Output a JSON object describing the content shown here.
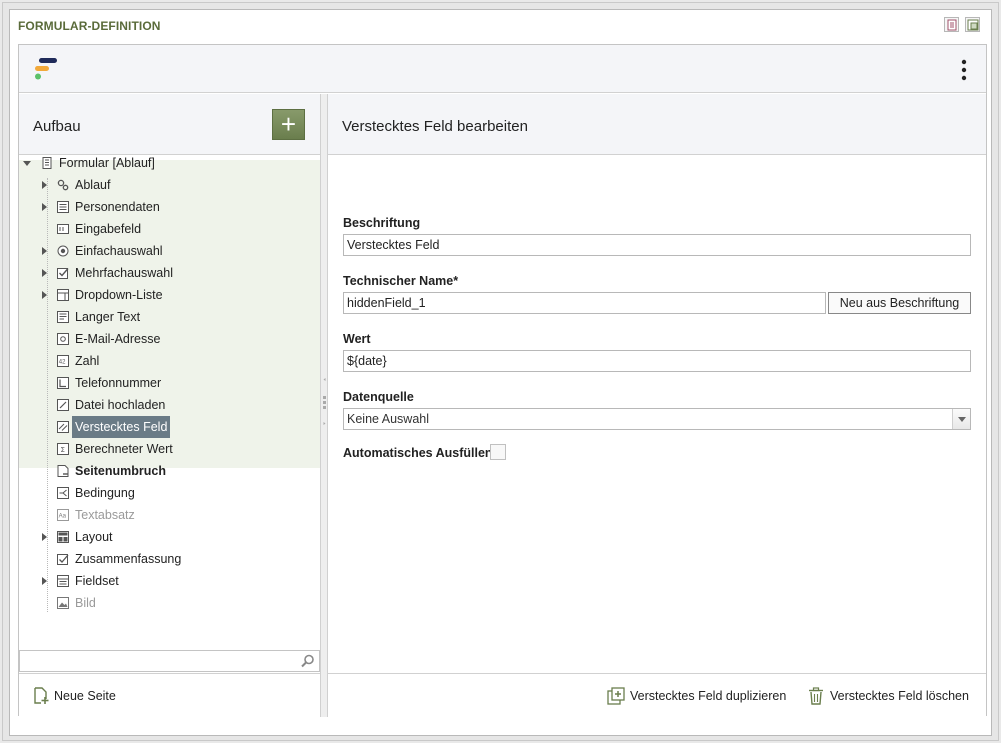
{
  "window": {
    "title": "FORMULAR-DEFINITION"
  },
  "left": {
    "title": "Aufbau",
    "add_label": "+",
    "tree": [
      {
        "label": "Formular [Ablauf]",
        "icon": "form-icon",
        "level": 0,
        "expander": "expanded"
      },
      {
        "label": "Ablauf",
        "icon": "gears-icon",
        "level": 1,
        "expander": "collapsed"
      },
      {
        "label": "Personendaten",
        "icon": "list-icon",
        "level": 1,
        "expander": "collapsed"
      },
      {
        "label": "Eingabefeld",
        "icon": "textfield-icon",
        "level": 1,
        "expander": "none"
      },
      {
        "label": "Einfachauswahl",
        "icon": "radio-icon",
        "level": 1,
        "expander": "collapsed"
      },
      {
        "label": "Mehrfachauswahl",
        "icon": "checkbox-icon",
        "level": 1,
        "expander": "collapsed"
      },
      {
        "label": "Dropdown-Liste",
        "icon": "dropdown-icon",
        "level": 1,
        "expander": "collapsed"
      },
      {
        "label": "Langer Text",
        "icon": "textarea-icon",
        "level": 1,
        "expander": "none"
      },
      {
        "label": "E-Mail-Adresse",
        "icon": "email-icon",
        "level": 1,
        "expander": "none"
      },
      {
        "label": "Zahl",
        "icon": "number-icon",
        "level": 1,
        "expander": "none"
      },
      {
        "label": "Telefonnummer",
        "icon": "phone-icon",
        "level": 1,
        "expander": "none"
      },
      {
        "label": "Datei hochladen",
        "icon": "upload-icon",
        "level": 1,
        "expander": "none"
      },
      {
        "label": "Verstecktes Feld",
        "icon": "hidden-field-icon",
        "level": 1,
        "expander": "none",
        "selected": true
      },
      {
        "label": "Berechneter Wert",
        "icon": "calculated-icon",
        "level": 1,
        "expander": "none"
      },
      {
        "label": "Seitenumbruch",
        "icon": "pagebreak-icon",
        "level": 1,
        "expander": "none",
        "bold": true
      },
      {
        "label": "Bedingung",
        "icon": "condition-icon",
        "level": 1,
        "expander": "none"
      },
      {
        "label": "Textabsatz",
        "icon": "paragraph-icon",
        "level": 1,
        "expander": "none",
        "muted": true
      },
      {
        "label": "Layout",
        "icon": "layout-icon",
        "level": 1,
        "expander": "collapsed"
      },
      {
        "label": "Zusammenfassung",
        "icon": "summary-icon",
        "level": 1,
        "expander": "none"
      },
      {
        "label": "Fieldset",
        "icon": "fieldset-icon",
        "level": 1,
        "expander": "collapsed"
      },
      {
        "label": "Bild",
        "icon": "image-icon",
        "level": 1,
        "expander": "none",
        "muted": true
      }
    ],
    "search": {
      "value": "",
      "placeholder": ""
    },
    "new_page_label": "Neue Seite"
  },
  "right": {
    "title": "Verstecktes Feld bearbeiten",
    "fields": {
      "beschriftung": {
        "label": "Beschriftung",
        "value": "Verstecktes Feld"
      },
      "technischer_name": {
        "label": "Technischer Name*",
        "value": "hiddenField_1",
        "button": "Neu aus Beschriftung"
      },
      "wert": {
        "label": "Wert",
        "value": "${date}"
      },
      "datenquelle": {
        "label": "Datenquelle",
        "value": "Keine Auswahl"
      },
      "auto_fill": {
        "label": "Automatisches Ausfüllen",
        "checked": false
      }
    },
    "actions": {
      "duplicate": "Verstecktes Feld duplizieren",
      "delete": "Verstecktes Feld löschen"
    }
  },
  "colors": {
    "accent_green": "#6a7e4d",
    "tree_band": "#eff3ea",
    "selected_bg": "#6a7b86",
    "logo_navy": "#1f2b5a",
    "logo_orange": "#f2a93b",
    "logo_green": "#5cc16a"
  }
}
